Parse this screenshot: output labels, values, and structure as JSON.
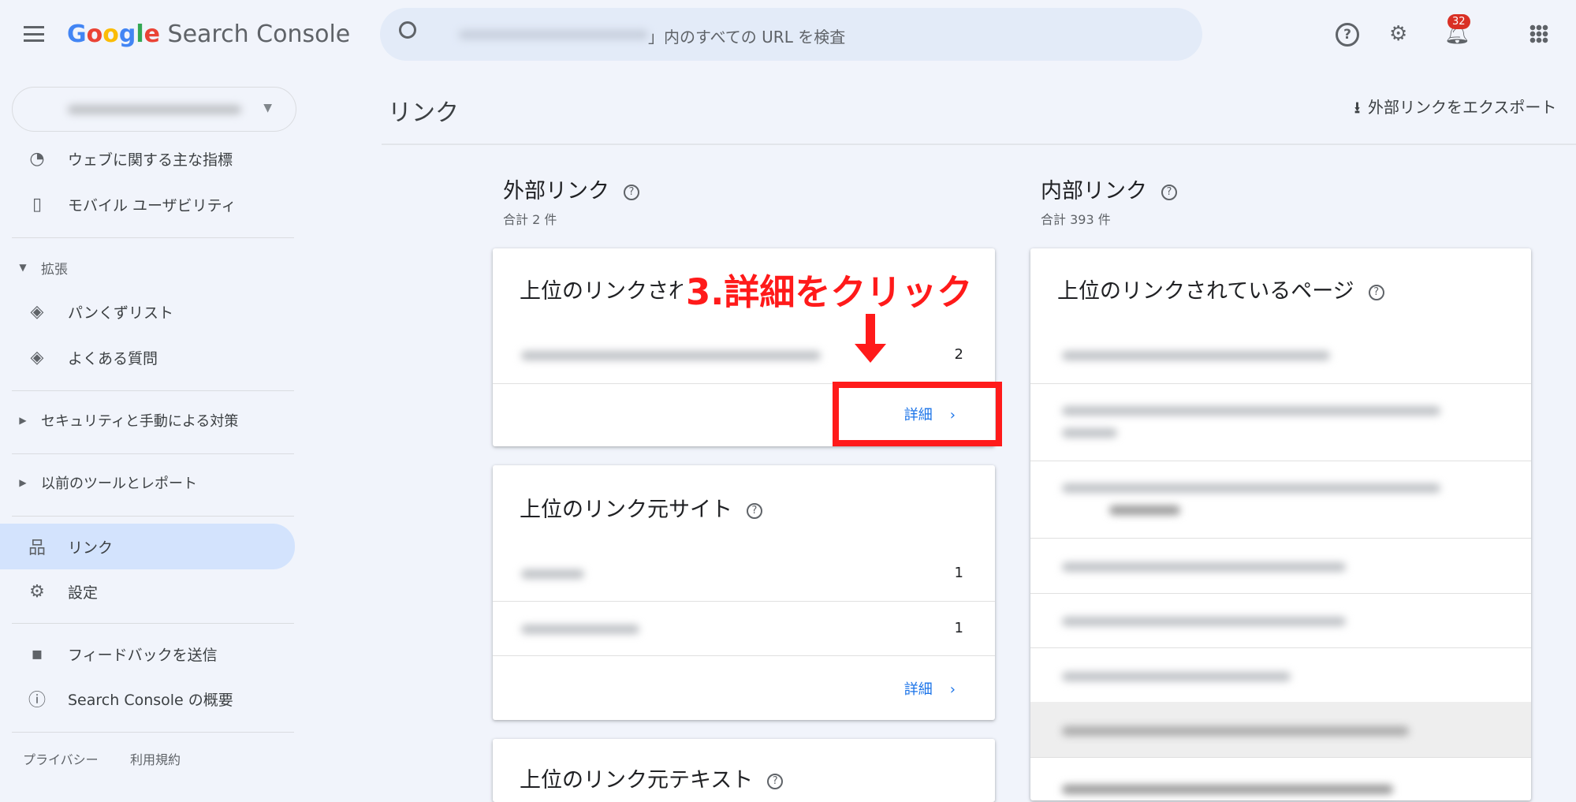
{
  "header": {
    "app_name_google": "Google",
    "app_name_rest": " Search Console",
    "search_placeholder": "」内のすべての URL を検査",
    "notification_count": "32"
  },
  "page": {
    "title": "リンク",
    "export_label": "外部リンクをエクスポート"
  },
  "sidebar": {
    "items": [
      {
        "label": "ウェブに関する主な指標",
        "icon": "speed-icon"
      },
      {
        "label": "モバイル ユーザビリティ",
        "icon": "phone-icon"
      },
      {
        "label": "拡張",
        "icon": "caret-down-icon"
      },
      {
        "label": "パンくずリスト",
        "icon": "layers-icon"
      },
      {
        "label": "よくある質問",
        "icon": "layers-icon"
      },
      {
        "label": "セキュリティと手動による対策",
        "icon": "caret-right-icon"
      },
      {
        "label": "以前のツールとレポート",
        "icon": "caret-right-icon"
      },
      {
        "label": "リンク",
        "icon": "sitemap-icon"
      },
      {
        "label": "設定",
        "icon": "gear-icon"
      },
      {
        "label": "フィードバックを送信",
        "icon": "feedback-icon"
      },
      {
        "label": "Search Console の概要",
        "icon": "info-icon"
      }
    ],
    "footer": {
      "privacy": "プライバシー",
      "terms": "利用規約"
    }
  },
  "external": {
    "title": "外部リンク",
    "total": "合計 2 件",
    "top_linked_pages": {
      "title": "上位のリンクされているページ",
      "rows": [
        {
          "count": "2"
        }
      ],
      "detail": "詳細"
    },
    "top_linking_sites": {
      "title": "上位のリンク元サイト",
      "rows": [
        {
          "count": "1"
        },
        {
          "count": "1"
        }
      ],
      "detail": "詳細"
    },
    "top_linking_text": {
      "title": "上位のリンク元テキスト"
    }
  },
  "internal": {
    "title": "内部リンク",
    "total": "合計 393 件",
    "top_linked_pages": {
      "title": "上位のリンクされているページ"
    }
  },
  "annotation": {
    "text": "3.詳細をクリック",
    "color": "#ff1a1a"
  },
  "colors": {
    "accent": "#1a73e8",
    "selected_bg": "#d3e3fd",
    "badge": "#d93025"
  }
}
